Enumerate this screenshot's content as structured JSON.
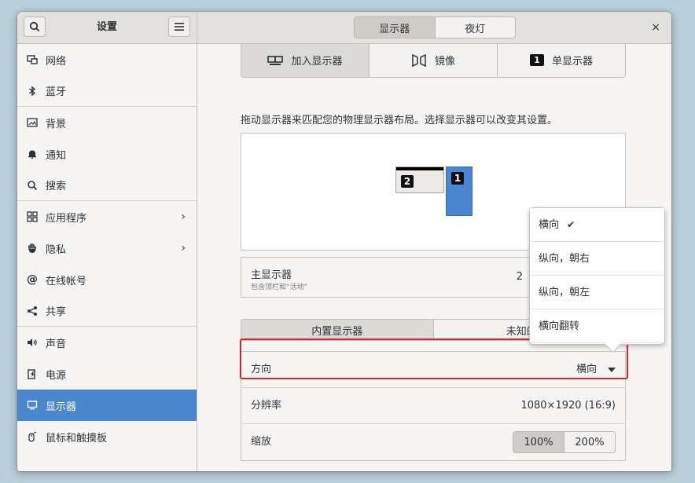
{
  "window": {
    "title": "设置",
    "close_label": "×",
    "view_switch": {
      "display": "显示器",
      "night_light": "夜灯"
    }
  },
  "sidebar": {
    "items": [
      {
        "label": "网络",
        "icon": "network-icon"
      },
      {
        "label": "蓝牙",
        "icon": "bluetooth-icon"
      },
      {
        "label": "背景",
        "icon": "background-icon"
      },
      {
        "label": "通知",
        "icon": "bell-icon"
      },
      {
        "label": "搜索",
        "icon": "search-icon"
      },
      {
        "label": "应用程序",
        "icon": "apps-grid-icon"
      },
      {
        "label": "隐私",
        "icon": "hand-icon"
      },
      {
        "label": "在线帐号",
        "icon": "at-icon"
      },
      {
        "label": "共享",
        "icon": "share-icon"
      },
      {
        "label": "声音",
        "icon": "speaker-icon"
      },
      {
        "label": "电源",
        "icon": "power-icon"
      },
      {
        "label": "显示器",
        "icon": "display-icon"
      },
      {
        "label": "鼠标和触摸板",
        "icon": "mouse-icon"
      }
    ],
    "active_color": "#4a87cf"
  },
  "display_modes": {
    "join": "加入显示器",
    "mirror": "镜像",
    "single": "单显示器",
    "single_badge": "1"
  },
  "arrangement": {
    "hint": "拖动显示器来匹配您的物理显示器布局。选择显示器可以改变其设置。",
    "monitor_left_badge": "2",
    "monitor_right_badge": "1"
  },
  "primary_display": {
    "title": "主显示器",
    "subtitle": "包含顶栏和“活动”",
    "value": "2"
  },
  "display_tabs": {
    "builtin": "内置显示器",
    "unknown": "未知的"
  },
  "settings": {
    "orientation": {
      "label": "方向",
      "value": "横向"
    },
    "resolution": {
      "label": "分辨率",
      "value": "1080×1920 (16:9)"
    },
    "scale": {
      "label": "缩放",
      "opt1": "100%",
      "opt2": "200%"
    }
  },
  "orientation_popover": {
    "items": [
      {
        "label": "横向",
        "check": "✔"
      },
      {
        "label": "纵向，朝右"
      },
      {
        "label": "纵向，朝左"
      },
      {
        "label": "横向翻转"
      }
    ]
  }
}
